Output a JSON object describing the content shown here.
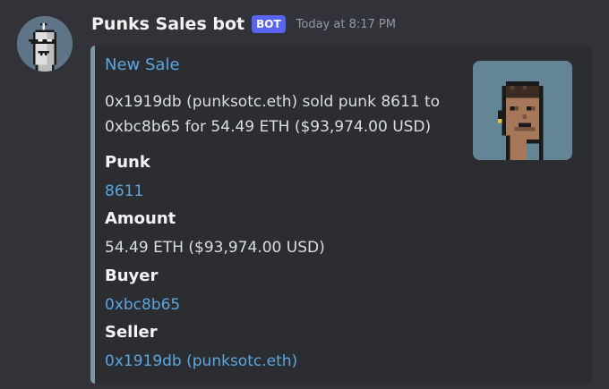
{
  "message": {
    "author": "Punks Sales bot",
    "bot_tag": "BOT",
    "timestamp": "Today at 8:17 PM",
    "avatar_icon": "robot-punk-icon",
    "avatar_color": "#5f7587"
  },
  "embed": {
    "accent_color": "#7d96a6",
    "title": "New Sale",
    "description": "0x1919db (punksotc.eth) sold punk 8611 to 0xbc8b65 for 54.49 ETH ($93,974.00 USD)",
    "thumbnail_icon": "cryptopunk-icon",
    "thumbnail_bg": "#638596",
    "fields": [
      {
        "name": "Punk",
        "value": "8611"
      },
      {
        "name": "Amount",
        "value": "54.49 ETH ($93,974.00 USD)"
      },
      {
        "name": "Buyer",
        "value": "0xbc8b65"
      },
      {
        "name": "Seller",
        "value": "0x1919db (punksotc.eth)"
      }
    ]
  },
  "colors": {
    "background": "#313338",
    "embed_background": "#2b2d31",
    "link": "#5aa6e0",
    "bot_badge": "#5865f2"
  }
}
